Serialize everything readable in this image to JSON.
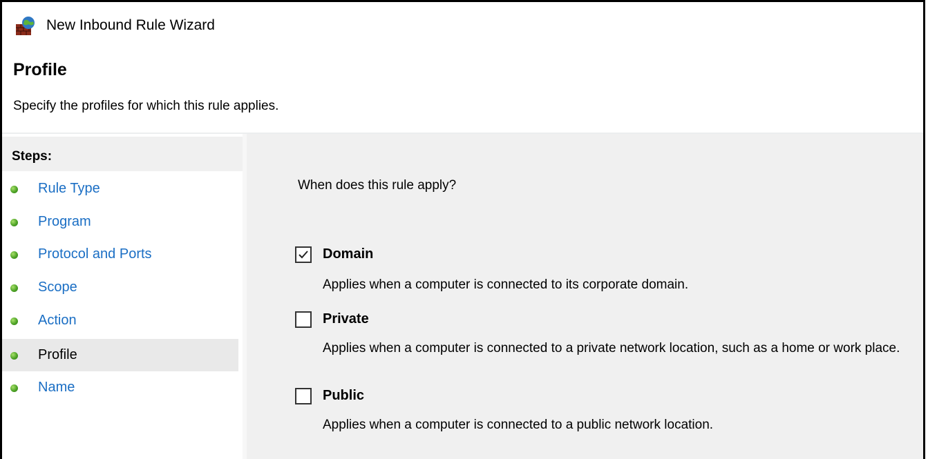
{
  "window": {
    "title": "New Inbound Rule Wizard",
    "icon": "firewall-globe-icon"
  },
  "header": {
    "title": "Profile",
    "subtitle": "Specify the profiles for which this rule applies."
  },
  "sidebar": {
    "header": "Steps:",
    "items": [
      {
        "label": "Rule Type",
        "active": false
      },
      {
        "label": "Program",
        "active": false
      },
      {
        "label": "Protocol and Ports",
        "active": false
      },
      {
        "label": "Scope",
        "active": false
      },
      {
        "label": "Action",
        "active": false
      },
      {
        "label": "Profile",
        "active": true
      },
      {
        "label": "Name",
        "active": false
      }
    ]
  },
  "main": {
    "question": "When does this rule apply?",
    "options": [
      {
        "label": "Domain",
        "checked": true,
        "description": "Applies when a computer is connected to its corporate domain."
      },
      {
        "label": "Private",
        "checked": false,
        "description": "Applies when a computer is connected to a private network location, such as a home or work place."
      },
      {
        "label": "Public",
        "checked": false,
        "description": "Applies when a computer is connected to a public network location."
      }
    ]
  },
  "colors": {
    "link": "#1a6ec4",
    "step_dot": "#4ea327",
    "content_bg": "#f0f0f0"
  }
}
